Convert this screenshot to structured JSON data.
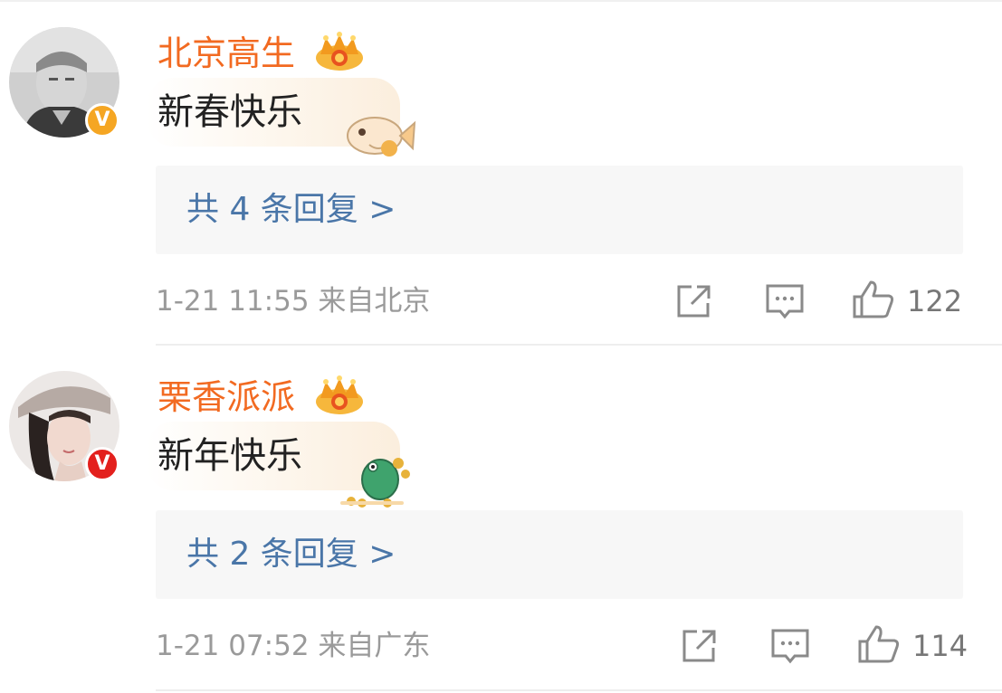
{
  "comments": [
    {
      "username": "北京高生",
      "verified_badge": "V",
      "badge_color": "#f5a623",
      "text": "新春快乐",
      "sticker": "fish-sticker-icon",
      "replies_label": "共 4 条回复 >",
      "time": "1-21 11:55",
      "location": "来自北京",
      "likes": "122"
    },
    {
      "username": "栗香派派",
      "verified_badge": "V",
      "badge_color": "#e3201d",
      "text": "新年快乐",
      "sticker": "frog-money-sticker-icon",
      "replies_label": "共 2 条回复 >",
      "time": "1-21 07:52",
      "location": "来自广东",
      "likes": "114"
    }
  ],
  "colors": {
    "username": "#f26a21",
    "reply_link": "#4a76a8",
    "meta": "#9a9a9a"
  }
}
